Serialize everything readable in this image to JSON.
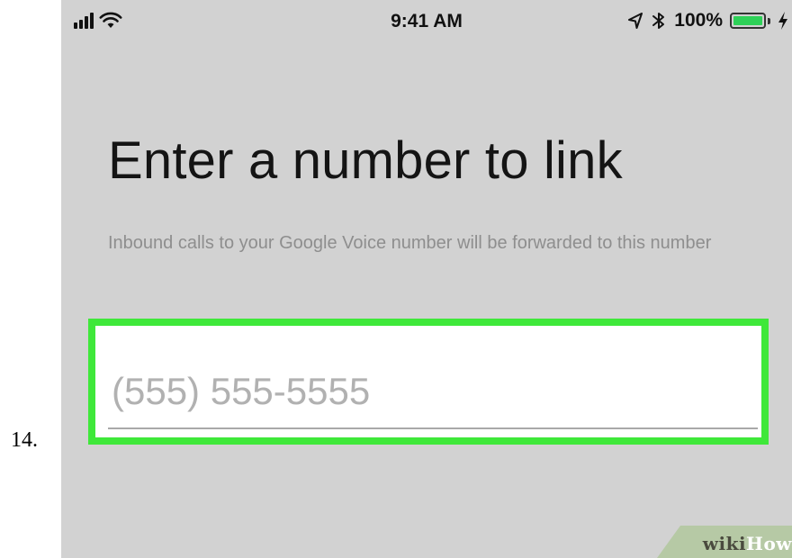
{
  "step_number": "14.",
  "status_bar": {
    "time": "9:41 AM",
    "battery_percent": "100%",
    "battery_level": 1.0,
    "battery_color": "#2ed158",
    "icons": [
      "signal-bars-icon",
      "wifi-icon",
      "location-arrow-icon",
      "bluetooth-icon",
      "battery-icon",
      "charging-bolt-icon"
    ]
  },
  "main": {
    "heading": "Enter a number to link",
    "subtext": "Inbound calls to your Google Voice number will be forwarded to this number",
    "phone_input": {
      "placeholder": "(555) 555-5555",
      "value": "",
      "highlight_color": "#3fe83a"
    }
  },
  "watermark": {
    "part1": "wiki",
    "part2": "How"
  }
}
